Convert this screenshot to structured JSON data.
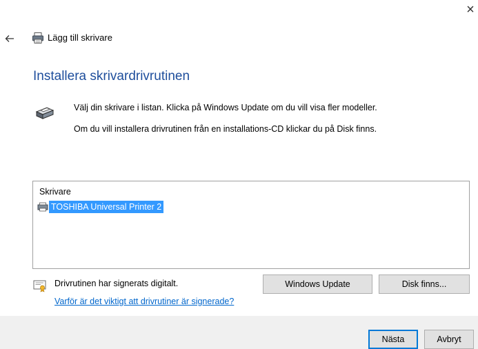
{
  "window": {
    "close_glyph": "×"
  },
  "wizard": {
    "title": "Lägg till skrivare"
  },
  "heading": "Installera skrivardrivrutinen",
  "instructions": {
    "line1": "Välj din skrivare i listan. Klicka på Windows Update om du vill visa fler modeller.",
    "line2": "Om du vill installera drivrutinen från en installations-CD klickar du på Disk finns."
  },
  "printer_list": {
    "header": "Skrivare",
    "items": [
      {
        "label": "TOSHIBA Universal Printer 2",
        "selected": true
      }
    ]
  },
  "signature": {
    "status": "Drivrutinen har signerats digitalt.",
    "link": "Varför är det viktigt att drivrutiner är signerade?"
  },
  "buttons": {
    "windows_update": "Windows Update",
    "have_disk": "Disk finns...",
    "next": "Nästa",
    "cancel": "Avbryt"
  },
  "icons": {
    "back": "back-arrow-icon",
    "wizard": "printer-icon",
    "header": "printer-driver-icon",
    "list_item": "printer-icon",
    "certificate": "certificate-icon"
  },
  "colors": {
    "heading": "#1e4e9c",
    "selection": "#3399ff",
    "link": "#0066cc",
    "footer": "#f0f0f0",
    "default_button_border": "#0078d7"
  }
}
